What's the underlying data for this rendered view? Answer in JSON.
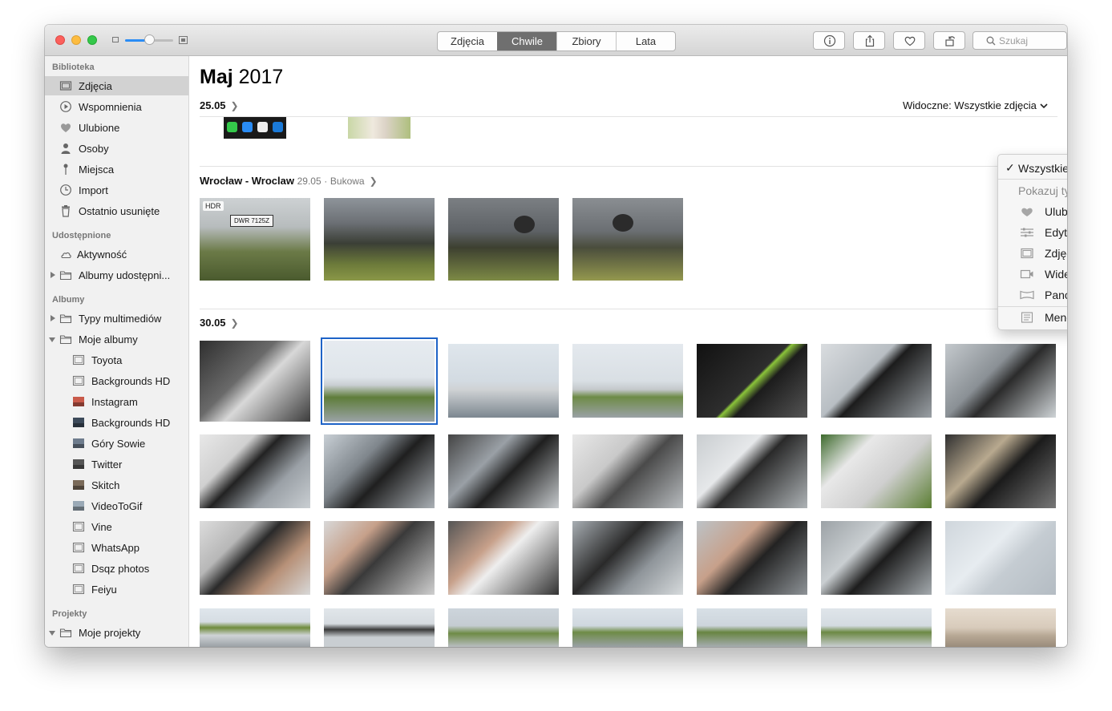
{
  "window": {
    "tabs": [
      {
        "label": "Zdjęcia",
        "active": false
      },
      {
        "label": "Chwile",
        "active": true
      },
      {
        "label": "Zbiory",
        "active": false
      },
      {
        "label": "Lata",
        "active": false
      }
    ],
    "search_placeholder": "Szukaj",
    "zoom_level": 0.5,
    "toolbar_icons": [
      "info-icon",
      "share-icon",
      "heart-icon",
      "rotate-icon"
    ]
  },
  "sidebar": {
    "library": {
      "title": "Biblioteka",
      "items": [
        {
          "label": "Zdjęcia",
          "icon": "photos-icon",
          "selected": true
        },
        {
          "label": "Wspomnienia",
          "icon": "memories-icon"
        },
        {
          "label": "Ulubione",
          "icon": "heart-icon"
        },
        {
          "label": "Osoby",
          "icon": "person-icon"
        },
        {
          "label": "Miejsca",
          "icon": "pin-icon"
        },
        {
          "label": "Import",
          "icon": "clock-icon"
        },
        {
          "label": "Ostatnio usunięte",
          "icon": "trash-icon"
        }
      ]
    },
    "shared": {
      "title": "Udostępnione",
      "items": [
        {
          "label": "Aktywność",
          "icon": "cloud-icon"
        },
        {
          "label": "Albumy udostępni...",
          "icon": "folder-icon"
        }
      ]
    },
    "albums": {
      "title": "Albumy",
      "items": [
        {
          "label": "Typy multimediów",
          "icon": "folder-icon"
        },
        {
          "label": "Moje albumy",
          "icon": "folder-icon"
        }
      ],
      "my_albums": [
        {
          "label": "Toyota",
          "icon": "album-icon"
        },
        {
          "label": "Backgrounds HD",
          "icon": "album-icon"
        },
        {
          "label": "Instagram",
          "icon": "album-thumb-icon"
        },
        {
          "label": "Backgrounds HD",
          "icon": "album-thumb-icon"
        },
        {
          "label": "Góry Sowie",
          "icon": "album-thumb-icon"
        },
        {
          "label": "Twitter",
          "icon": "album-thumb-icon"
        },
        {
          "label": "Skitch",
          "icon": "album-thumb-icon"
        },
        {
          "label": "VideoToGif",
          "icon": "album-thumb-icon"
        },
        {
          "label": "Vine",
          "icon": "album-icon"
        },
        {
          "label": "WhatsApp",
          "icon": "album-icon"
        },
        {
          "label": "Dsqz photos",
          "icon": "album-icon"
        },
        {
          "label": "Feiyu",
          "icon": "album-icon"
        }
      ]
    },
    "projects": {
      "title": "Projekty",
      "items": [
        {
          "label": "Moje projekty",
          "icon": "folder-icon"
        }
      ]
    }
  },
  "main": {
    "month": "Maj",
    "year": "2017",
    "visible_label": "Widoczne: Wszystkie zdjęcia",
    "groups": [
      {
        "date": "25.05",
        "location": "",
        "sublocation": ""
      },
      {
        "date": "29.05",
        "location": "Wrocław - Wroclaw",
        "sublocation": "Bukowa"
      },
      {
        "date": "30.05",
        "location": "",
        "sublocation": ""
      }
    ],
    "hdr_badge": "HDR",
    "plate_text": "DWR 7125Z"
  },
  "dropdown": {
    "checked": "Wszystkie zdjęcia",
    "section": "Pokazuj tylko:",
    "options": [
      {
        "label": "Ulubione",
        "icon": "heart-icon"
      },
      {
        "label": "Edytowane",
        "icon": "sliders-icon"
      },
      {
        "label": "Zdjęcia",
        "icon": "photos-icon"
      },
      {
        "label": "Wideo",
        "icon": "video-icon"
      },
      {
        "label": "Panoramy",
        "icon": "panorama-icon"
      }
    ],
    "keywords": "Menedżer słów kluczowych."
  }
}
